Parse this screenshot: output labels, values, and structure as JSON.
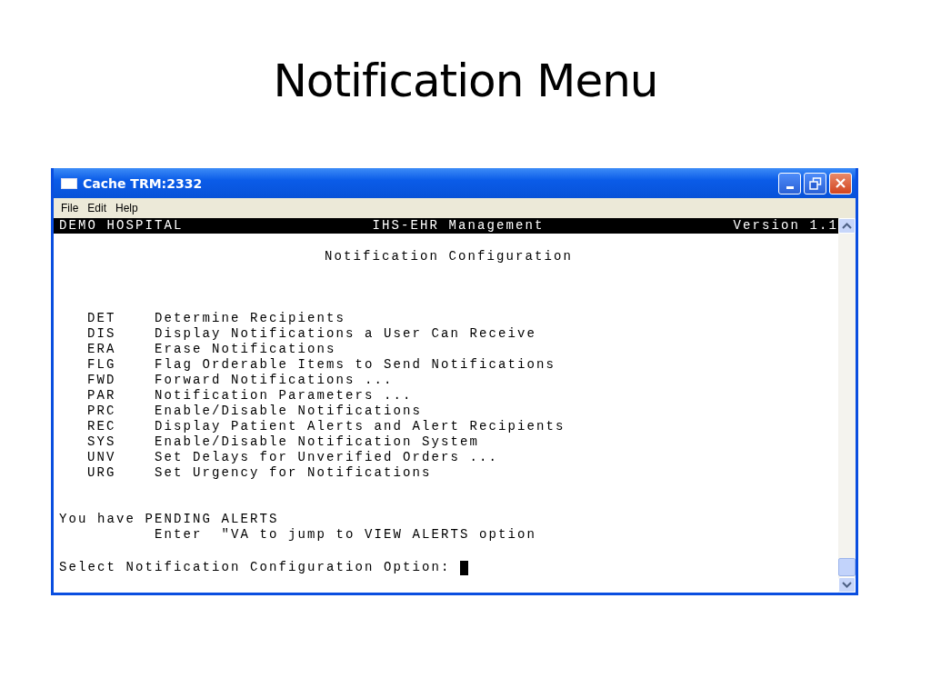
{
  "slide_title": "Notification Menu",
  "window": {
    "title": "Cache TRM:2332",
    "menu": [
      "File",
      "Edit",
      "Help"
    ]
  },
  "terminal": {
    "header": {
      "left": "DEMO HOSPITAL",
      "center": "IHS-EHR Management",
      "right": "Version 1.1"
    },
    "screen_title": "Notification Configuration",
    "options": [
      {
        "code": "DET",
        "label": "Determine Recipients"
      },
      {
        "code": "DIS",
        "label": "Display Notifications a User Can Receive"
      },
      {
        "code": "ERA",
        "label": "Erase Notifications"
      },
      {
        "code": "FLG",
        "label": "Flag Orderable Items to Send Notifications"
      },
      {
        "code": "FWD",
        "label": "Forward Notifications ..."
      },
      {
        "code": "PAR",
        "label": "Notification Parameters ..."
      },
      {
        "code": "PRC",
        "label": "Enable/Disable Notifications"
      },
      {
        "code": "REC",
        "label": "Display Patient Alerts and Alert Recipients"
      },
      {
        "code": "SYS",
        "label": "Enable/Disable Notification System"
      },
      {
        "code": "UNV",
        "label": "Set Delays for Unverified Orders ..."
      },
      {
        "code": "URG",
        "label": "Set Urgency for Notifications"
      }
    ],
    "alert_notice": "You have PENDING ALERTS",
    "alert_hint": "Enter  \"VA to jump to VIEW ALERTS option",
    "prompt": "Select Notification Configuration Option:"
  }
}
